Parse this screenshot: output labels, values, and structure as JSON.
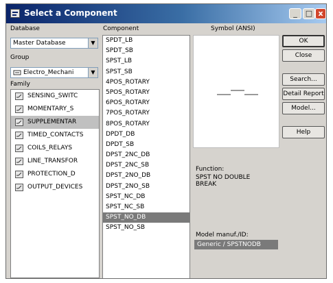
{
  "window": {
    "title": "Select a Component"
  },
  "titlebar": {
    "min": "_",
    "max": "□",
    "close": "x"
  },
  "database": {
    "label": "Database",
    "value": "Master Database"
  },
  "group": {
    "label": "Group",
    "value": "Electro_Mechani"
  },
  "family": {
    "label": "Family",
    "items": [
      {
        "label": "SENSING_SWITC",
        "icon": "sensing-switch-icon",
        "selected": false
      },
      {
        "label": "MOMENTARY_S",
        "icon": "momentary-switch-icon",
        "selected": false
      },
      {
        "label": "SUPPLEMENTAR",
        "icon": "supplementary-switch-icon",
        "selected": true
      },
      {
        "label": "TIMED_CONTACTS",
        "icon": "timed-contacts-icon",
        "selected": false
      },
      {
        "label": "COILS_RELAYS",
        "icon": "coils-relays-icon",
        "selected": false
      },
      {
        "label": "LINE_TRANSFOR",
        "icon": "line-transformer-icon",
        "selected": false
      },
      {
        "label": "PROTECTION_D",
        "icon": "protection-device-icon",
        "selected": false
      },
      {
        "label": "OUTPUT_DEVICES",
        "icon": "output-devices-icon",
        "selected": false
      }
    ]
  },
  "component": {
    "label": "Component",
    "items": [
      "SPDT_LB",
      "SPDT_SB",
      "SPST_LB",
      "SPST_SB",
      "4POS_ROTARY",
      "5POS_ROTARY",
      "6POS_ROTARY",
      "7POS_ROTARY",
      "8POS_ROTARY",
      "DPDT_DB",
      "DPDT_SB",
      "DPST_2NC_DB",
      "DPST_2NC_SB",
      "DPST_2NO_DB",
      "DPST_2NO_SB",
      "SPST_NC_DB",
      "SPST_NC_SB",
      "SPST_NO_DB",
      "SPST_NO_SB"
    ],
    "selected_index": 17
  },
  "symbol": {
    "label": "Symbol (ANSI)"
  },
  "function": {
    "label": "Function:",
    "value": "SPST NO DOUBLE\nBREAK"
  },
  "model_manuf": {
    "label": "Model manuf./ID:",
    "value": "Generic / SPSTNODB"
  },
  "buttons": {
    "ok": "OK",
    "close": "Close",
    "search": "Search...",
    "detail_report": "Detail Report",
    "model": "Model...",
    "help": "Help"
  }
}
